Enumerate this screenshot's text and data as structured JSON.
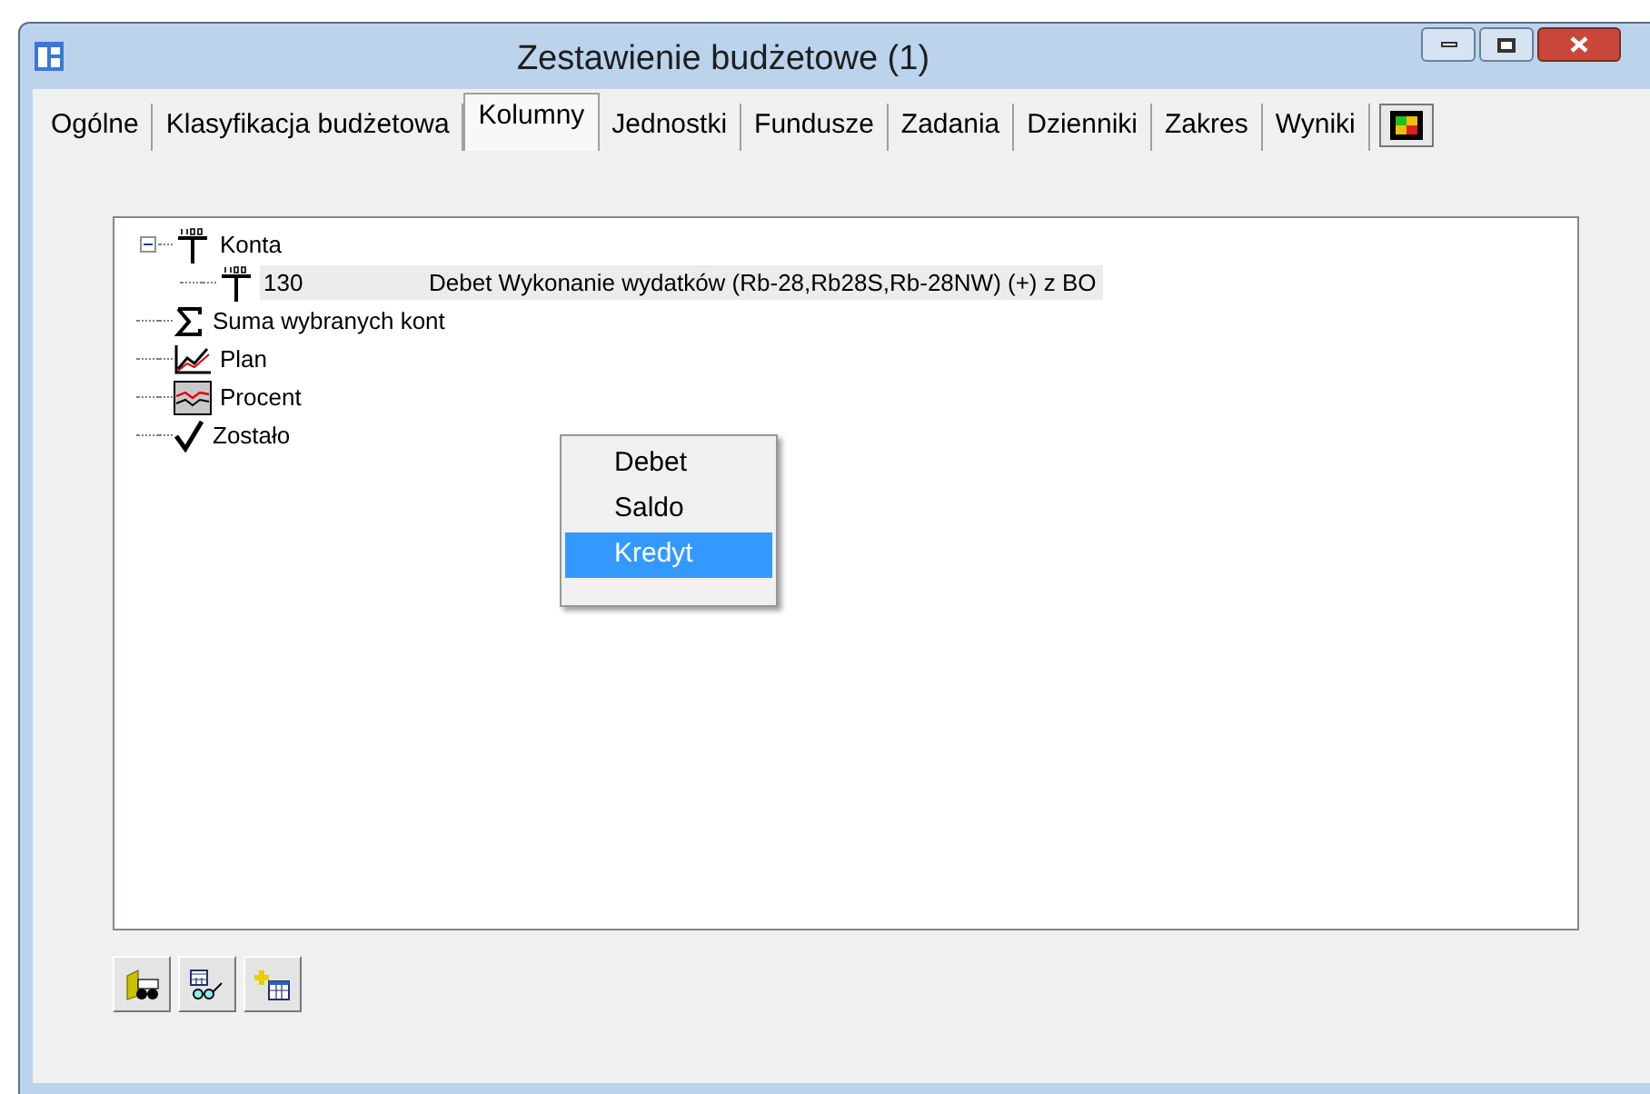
{
  "window": {
    "title": "Zestawienie budżetowe (1)"
  },
  "tabs": [
    {
      "label": "Ogólne",
      "selected": false
    },
    {
      "label": "Klasyfikacja budżetowa",
      "selected": false
    },
    {
      "label": "Kolumny",
      "selected": true
    },
    {
      "label": "Jednostki",
      "selected": false
    },
    {
      "label": "Fundusze",
      "selected": false
    },
    {
      "label": "Zadania",
      "selected": false
    },
    {
      "label": "Dzienniki",
      "selected": false
    },
    {
      "label": "Zakres",
      "selected": false
    },
    {
      "label": "Wyniki",
      "selected": false
    }
  ],
  "tree": [
    {
      "kind": "account",
      "label": "Konta",
      "expanded": true,
      "children": [
        {
          "kind": "account",
          "label": "130",
          "description": "Debet Wykonanie wydatków (Rb-28,Rb28S,Rb-28NW) (+) z BO",
          "selected": true
        }
      ]
    },
    {
      "kind": "sum",
      "label": "Suma wybranych kont"
    },
    {
      "kind": "plan",
      "label": "Plan"
    },
    {
      "kind": "percent",
      "label": "Procent"
    },
    {
      "kind": "check",
      "label": "Zostało"
    }
  ],
  "context_menu": [
    {
      "label": "Debet",
      "selected": false
    },
    {
      "label": "Saldo",
      "selected": false
    },
    {
      "label": "Kredyt",
      "selected": true
    }
  ]
}
